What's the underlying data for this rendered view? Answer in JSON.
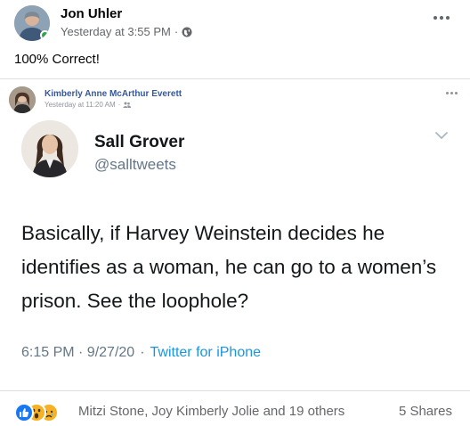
{
  "post": {
    "author": "Jon Uhler",
    "timestamp": "Yesterday at 3:55 PM",
    "separator": "·",
    "privacy_icon": "globe-icon",
    "more_icon": "more-options-icon",
    "text": "100% Correct!"
  },
  "shared_post": {
    "author": "Kimberly Anne McArthur Everett",
    "timestamp": "Yesterday at 11:20 AM",
    "separator": "·",
    "privacy_icon": "friends-icon",
    "more_icon": "more-options-icon"
  },
  "tweet": {
    "name": "Sall Grover",
    "handle": "@salltweets",
    "text": "Basically, if Harvey Weinstein decides he identifies as a woman, he can go to a women’s prison. See the loophole?",
    "time": "6:15 PM · 9/27/20",
    "separator": "·",
    "source": "Twitter for iPhone"
  },
  "reactions": {
    "icons": [
      "like-icon",
      "wow-icon",
      "sad-icon"
    ],
    "names": "Mitzi Stone, Joy Kimberly Jolie and 19 others",
    "shares": "5 Shares"
  },
  "colors": {
    "facebook_blue": "#1877f2",
    "twitter_link": "#1b95e0",
    "secondary_text": "#65676b",
    "online_green": "#31a24c",
    "reaction_yellow": "#f7b125"
  }
}
